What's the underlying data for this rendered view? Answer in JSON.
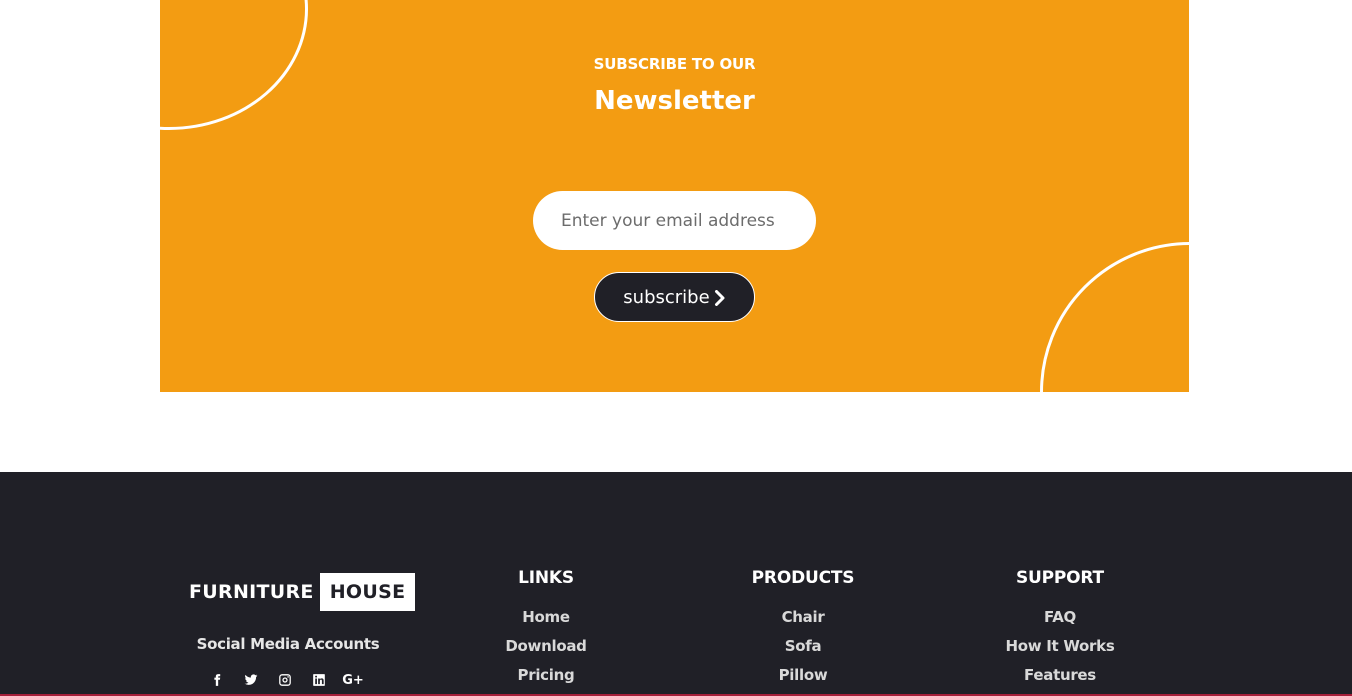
{
  "newsletter": {
    "eyebrow": "SUBSCRIBE TO OUR",
    "title": "Newsletter",
    "email_placeholder": "Enter your email address",
    "button_label": "subscribe",
    "button_icon": "chevron-right-icon",
    "background_color": "#f39c12"
  },
  "footer": {
    "background_color": "#202027",
    "brand": {
      "part_one": "FURNITURE",
      "part_two": "HOUSE"
    },
    "social": {
      "label": "Social Media Accounts",
      "icons": [
        "facebook-icon",
        "twitter-icon",
        "instagram-icon",
        "linkedin-icon",
        "google-plus-icon"
      ],
      "google_plus_text": "G+"
    },
    "links": {
      "heading": "LINKS",
      "items": [
        "Home",
        "Download",
        "Pricing"
      ]
    },
    "products": {
      "heading": "PRODUCTS",
      "items": [
        "Chair",
        "Sofa",
        "Pillow"
      ]
    },
    "support": {
      "heading": "SUPPORT",
      "items": [
        "FAQ",
        "How It Works",
        "Features"
      ]
    }
  }
}
